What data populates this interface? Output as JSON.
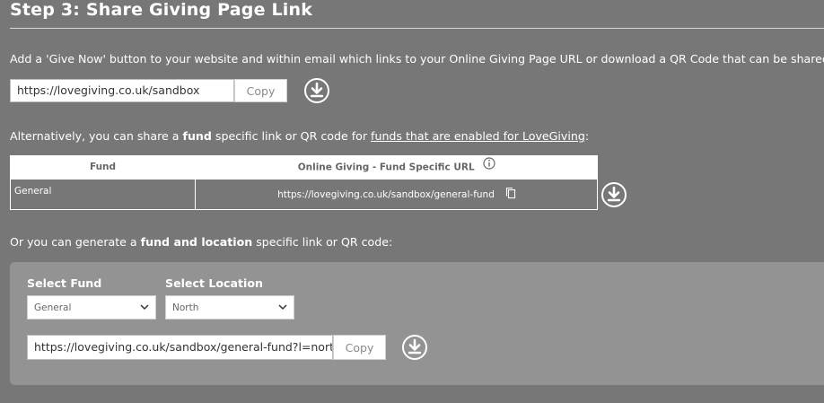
{
  "section": {
    "title": "Step 3: Share Giving Page Link"
  },
  "intro": {
    "text": "Add a 'Give Now' button to your website and within email which links to your Online Giving Page URL or download a QR Code that can be shared."
  },
  "main_link": {
    "url": "https://lovegiving.co.uk/sandbox",
    "copy_label": "Copy",
    "download_icon": "download-circle-icon"
  },
  "alt": {
    "prefix": "Alternatively, you can share a ",
    "bold": "fund",
    "middle": " specific link or QR code for ",
    "link": "funds that are enabled for LoveGiving",
    "suffix": ":"
  },
  "fund_table": {
    "headers": [
      "Fund",
      "Online Giving - Fund Specific URL"
    ],
    "rows": [
      {
        "fund": "General",
        "url": "https://lovegiving.co.uk/sandbox/general-fund"
      }
    ],
    "info_icon": "info-icon",
    "copy_icon": "copy-icon"
  },
  "location_section": {
    "prefix": "Or you can generate a ",
    "bold": "fund and location",
    "suffix": " specific link or QR code:",
    "fund_label": "Select Fund",
    "location_label": "Select Location",
    "fund_selected": "General",
    "location_selected": "North",
    "url": "https://lovegiving.co.uk/sandbox/general-fund?l=north",
    "copy_label": "Copy"
  },
  "colors": {
    "background": "#777777",
    "panel": "#939393",
    "text": "#ffffff"
  }
}
